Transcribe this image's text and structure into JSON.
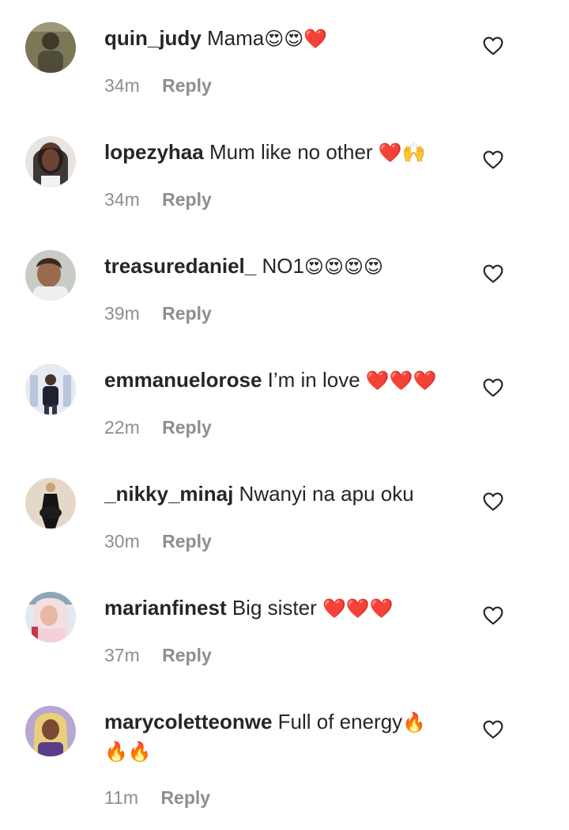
{
  "comments": [
    {
      "username": "quin_judy",
      "text": "Mama",
      "emoji": "😍😍❤️",
      "time": "34m",
      "reply": "Reply",
      "avatar_color": "#6b6a4f"
    },
    {
      "username": "lopezyhaa",
      "text": "Mum like no other ",
      "emoji": "❤️🙌",
      "time": "34m",
      "reply": "Reply",
      "avatar_color": "#2b2320"
    },
    {
      "username": "treasuredaniel_",
      "text": "NO1",
      "emoji": "😍😍😍😍",
      "time": "39m",
      "reply": "Reply",
      "avatar_color": "#c9b9ae"
    },
    {
      "username": "emmanuelorose",
      "text": "I’m in love ",
      "emoji": "❤️❤️❤️",
      "time": "22m",
      "reply": "Reply",
      "avatar_color": "#dfe4ee"
    },
    {
      "username": "_nikky_minaj",
      "text": "Nwanyi na apu oku",
      "emoji": "",
      "time": "30m",
      "reply": "Reply",
      "avatar_color": "#e3d3c2"
    },
    {
      "username": "marianfinest",
      "text": "Big sister ",
      "emoji": "❤️❤️❤️",
      "time": "37m",
      "reply": "Reply",
      "avatar_color": "#e9c9cf"
    },
    {
      "username": "marycoletteonwe",
      "text": "Full of energy",
      "emoji": "🔥🔥🔥",
      "time": "11m",
      "reply": "Reply",
      "avatar_color": "#8a7fa8"
    }
  ],
  "colors": {
    "text": "#262626",
    "muted": "#8e8e8e",
    "heart_outline": "#262626"
  },
  "icons": {
    "like": "heart-outline-icon"
  }
}
